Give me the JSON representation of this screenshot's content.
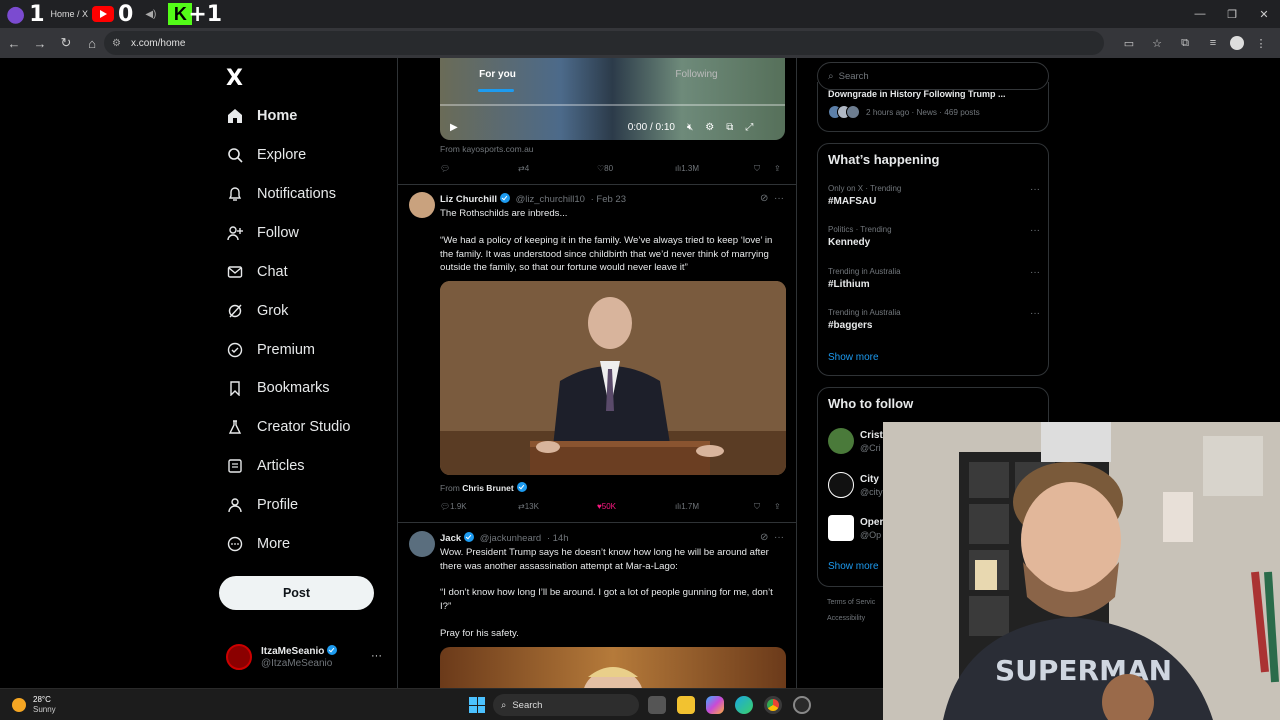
{
  "browser": {
    "tab_title": "Home / X",
    "score_left": "1",
    "score_mid": "0",
    "score_right": "+1",
    "url": "x.com/home"
  },
  "nav": {
    "logo": "X",
    "items": [
      {
        "label": "Home",
        "icon": "home-icon"
      },
      {
        "label": "Explore",
        "icon": "search-icon"
      },
      {
        "label": "Notifications",
        "icon": "bell-icon"
      },
      {
        "label": "Follow",
        "icon": "person-add-icon"
      },
      {
        "label": "Chat",
        "icon": "mail-icon"
      },
      {
        "label": "Grok",
        "icon": "grok-icon"
      },
      {
        "label": "Premium",
        "icon": "verified-icon"
      },
      {
        "label": "Bookmarks",
        "icon": "bookmark-icon"
      },
      {
        "label": "Creator Studio",
        "icon": "flask-icon"
      },
      {
        "label": "Articles",
        "icon": "article-icon"
      },
      {
        "label": "Profile",
        "icon": "person-icon"
      },
      {
        "label": "More",
        "icon": "more-circle-icon"
      }
    ],
    "post_label": "Post",
    "account": {
      "name": "ItzaMeSeanio",
      "handle": "@ItzaMeSeanio"
    }
  },
  "feed": {
    "tabs": [
      "For you",
      "Following"
    ],
    "video1": {
      "time": "0:00 / 0:10",
      "source": "From kayosports.com.au",
      "reposts": "4",
      "likes": "80",
      "views": "1.3M"
    },
    "tweet1": {
      "name": "Liz Churchill",
      "handle": "@liz_churchill10",
      "date": "· Feb 23",
      "line1": "The Rothschilds are inbreds...",
      "quote": "“We had a policy of keeping it in the family. We’ve always tried to keep ‘love’ in the family. It was understood since childbirth that we’d never think of marrying outside the family, so that our fortune would never leave it”",
      "from_prefix": "From",
      "from_name": "Chris Brunet",
      "replies": "1.9K",
      "reposts": "13K",
      "likes": "50K",
      "views": "1.7M",
      "like_color": "#f91880"
    },
    "tweet2": {
      "name": "Jack",
      "handle": "@jackunheard",
      "date": "· 14h",
      "p1": "Wow. President Trump says he doesn’t know how long he will be around after there was another assassination attempt at Mar-a-Lago:",
      "p2": "“I don’t know how long I’ll be around. I got a lot of people gunning for me, don’t I?”",
      "p3": "Pray for his safety."
    }
  },
  "right": {
    "search_placeholder": "Search",
    "news": {
      "title": "Downgrade in History Following Trump ...",
      "meta": "2 hours ago · News · 469 posts"
    },
    "whats_happening": {
      "title": "What’s happening",
      "trends": [
        {
          "context": "Only on X · Trending",
          "name": "#MAFSAU"
        },
        {
          "context": "Politics · Trending",
          "name": "Kennedy"
        },
        {
          "context": "Trending in Australia",
          "name": "#Lithium"
        },
        {
          "context": "Trending in Australia",
          "name": "#baggers"
        }
      ],
      "show_more": "Show more"
    },
    "who_to_follow": {
      "title": "Who to follow",
      "accounts": [
        {
          "name": "Crist",
          "handle": "@Cri"
        },
        {
          "name": "City",
          "handle": "@city"
        },
        {
          "name": "Oper",
          "handle": "@Op"
        }
      ],
      "show_more": "Show more"
    },
    "footer": {
      "terms": "Terms of Servic",
      "accessibility": "Accessibility"
    }
  },
  "taskbar": {
    "temp": "28°C",
    "condition": "Sunny",
    "search_label": "Search"
  },
  "colors": {
    "accent": "#1d9bf0",
    "like": "#f91880",
    "background": "#000000"
  }
}
